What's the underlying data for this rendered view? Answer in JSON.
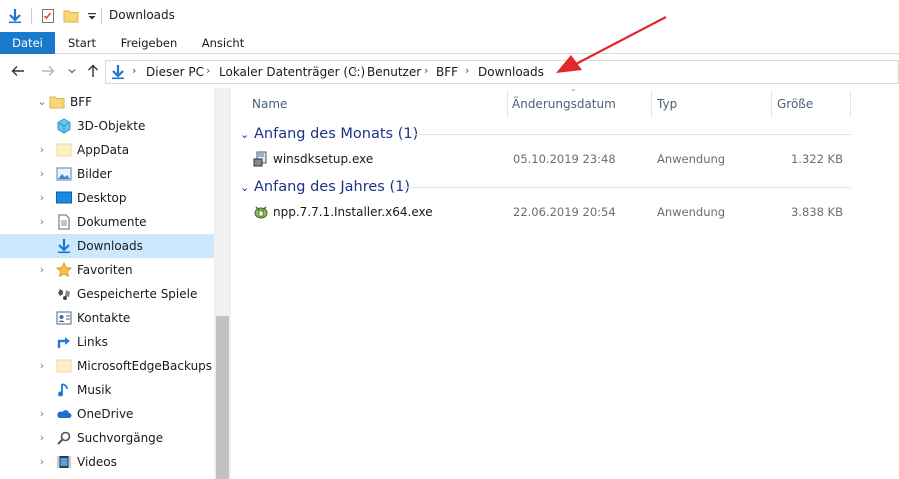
{
  "window": {
    "title": "Downloads"
  },
  "ribbon": {
    "tabs": [
      {
        "label": "Datei"
      },
      {
        "label": "Start"
      },
      {
        "label": "Freigeben"
      },
      {
        "label": "Ansicht"
      }
    ]
  },
  "address_bar": {
    "breadcrumbs": [
      {
        "label": "Dieser PC"
      },
      {
        "label": "Lokaler Datenträger (C:)"
      },
      {
        "label": "Benutzer"
      },
      {
        "label": "BFF"
      },
      {
        "label": "Downloads"
      }
    ]
  },
  "nav_pane": {
    "items": [
      {
        "label": "BFF",
        "icon": "folder-icon",
        "expanded": true
      },
      {
        "label": "3D-Objekte",
        "icon": "3d-objects-icon"
      },
      {
        "label": "AppData",
        "icon": "folder-icon"
      },
      {
        "label": "Bilder",
        "icon": "pictures-icon"
      },
      {
        "label": "Desktop",
        "icon": "desktop-icon"
      },
      {
        "label": "Dokumente",
        "icon": "documents-icon"
      },
      {
        "label": "Downloads",
        "icon": "downloads-icon",
        "selected": true
      },
      {
        "label": "Favoriten",
        "icon": "star-icon"
      },
      {
        "label": "Gespeicherte Spiele",
        "icon": "saved-games-icon"
      },
      {
        "label": "Kontakte",
        "icon": "contacts-icon"
      },
      {
        "label": "Links",
        "icon": "links-icon"
      },
      {
        "label": "MicrosoftEdgeBackups",
        "icon": "folder-icon"
      },
      {
        "label": "Musik",
        "icon": "music-icon"
      },
      {
        "label": "OneDrive",
        "icon": "onedrive-icon"
      },
      {
        "label": "Suchvorgänge",
        "icon": "search-icon"
      },
      {
        "label": "Videos",
        "icon": "videos-icon"
      }
    ]
  },
  "file_list": {
    "columns": [
      {
        "label": "Name"
      },
      {
        "label": "Änderungsdatum"
      },
      {
        "label": "Typ"
      },
      {
        "label": "Größe"
      }
    ],
    "groups": [
      {
        "label": "Anfang des Monats (1)",
        "files": [
          {
            "name": "winsdksetup.exe",
            "date": "05.10.2019 23:48",
            "type": "Anwendung",
            "size": "1.322 KB",
            "icon": "installer-icon"
          }
        ]
      },
      {
        "label": "Anfang des Jahres (1)",
        "files": [
          {
            "name": "npp.7.7.1.Installer.x64.exe",
            "date": "22.06.2019 20:54",
            "type": "Anwendung",
            "size": "3.838 KB",
            "icon": "notepadpp-icon"
          }
        ]
      }
    ]
  },
  "colors": {
    "accent": "#1979ca",
    "selection": "#cce8ff",
    "group_header": "#1e3287",
    "annotation_arrow": "#e3262b"
  }
}
